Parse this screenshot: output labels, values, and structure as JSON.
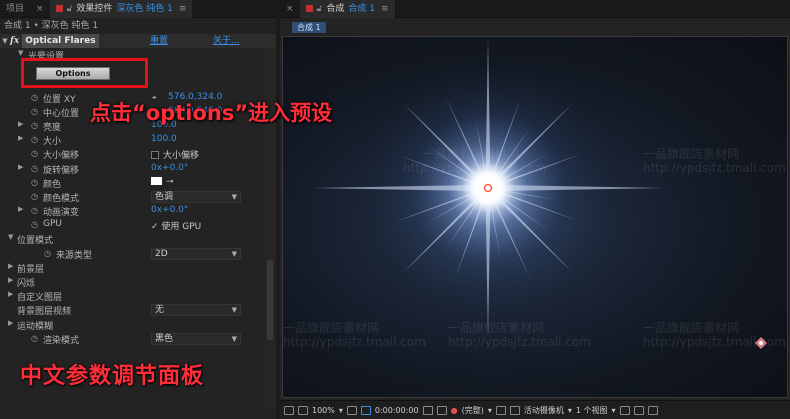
{
  "left_panel": {
    "tabs": {
      "project": "项目",
      "effect_controls": "效果控件",
      "layer": "深灰色 纯色 1",
      "menu": "≡"
    },
    "breadcrumb": "合成 1 • 深灰色 纯色 1",
    "effect": {
      "fx": "fx",
      "name": "Optical Flares",
      "reset": "重置",
      "about": "关于..."
    },
    "options_label": "Options",
    "rows": {
      "flare_setup": "光晕设置",
      "position_xy": "位置 XY",
      "position_xy_value": "576.0,324.0",
      "center": "中心位置",
      "center_value": "960.0,540.0",
      "brightness": "亮度",
      "brightness_value": "100.0",
      "scale": "大小",
      "scale_value": "100.0",
      "scale_offset": "大小偏移",
      "scale_offset_check": "大小偏移",
      "rotation_offset": "旋转偏移",
      "rotation_offset_value": "0x+0.0°",
      "color": "颜色",
      "color_mode": "颜色模式",
      "color_mode_value": "色调",
      "animation_evolution": "动画演变",
      "animation_evolution_value": "0x+0.0°",
      "gpu": "GPU",
      "gpu_check": "使用 GPU",
      "position_mode": "位置模式",
      "source_type": "来源类型",
      "source_type_value": "2D",
      "foreground_layers": "前景层",
      "flicker": "闪烁",
      "custom_layers": "自定义图层",
      "bg_layer_visibility": "背景图层视频",
      "bg_layer_visibility_value": "无",
      "motion_blur": "运动模糊",
      "render_mode": "渲染模式",
      "render_mode_value": "黑色"
    }
  },
  "annotations": {
    "middle": "点击“options”进入预设",
    "bottom": "中文参数调节面板"
  },
  "right_panel": {
    "tabs": {
      "close": "×",
      "title": "合成",
      "comp": "合成 1",
      "menu": "≡"
    },
    "comp_chip": "合成 1",
    "toolbar": {
      "zoom": "100%",
      "timecode": "0:00:00:00",
      "resolution": "(完整)",
      "camera": "活动摄像机",
      "views": "1 个视图"
    },
    "watermarks": {
      "w1": "一品旗舰店",
      "w2": "一品旗舰店素材网",
      "w3": "http://ypdsjfz.tmall.com"
    }
  },
  "colors": {
    "accent_blue": "#3b8fe8",
    "annotation_red": "#ff2e38",
    "highlight_box": "#e5141c"
  }
}
